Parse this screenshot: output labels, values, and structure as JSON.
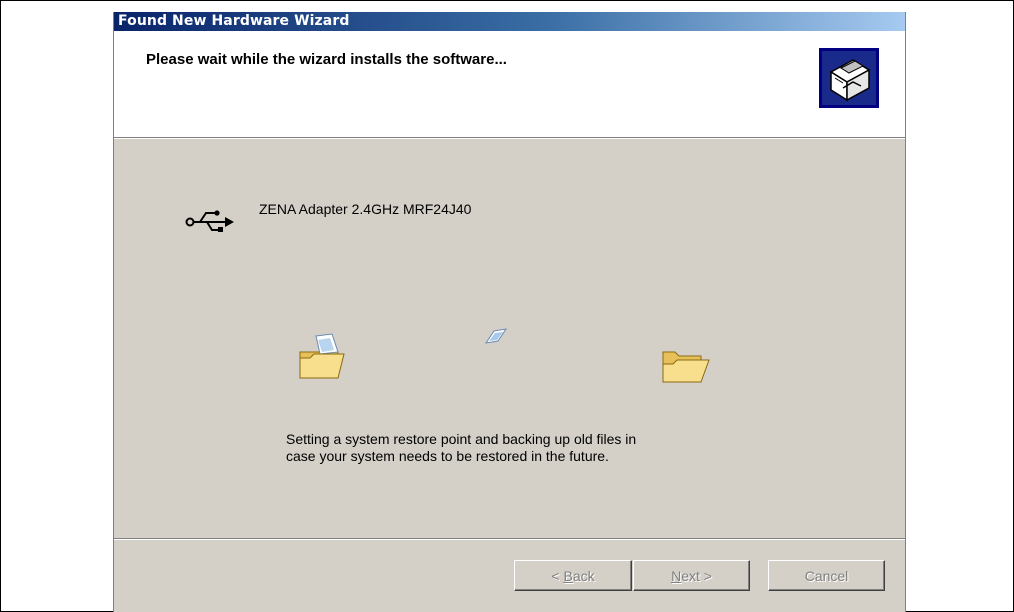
{
  "window": {
    "title": "Found New Hardware Wizard"
  },
  "header": {
    "title": "Please wait while the wizard installs the software...",
    "icon": "hardware-box-icon"
  },
  "device": {
    "icon": "usb-icon",
    "name": "ZENA Adapter 2.4GHz MRF24J40"
  },
  "animation": {
    "source_icon": "folder-with-document-icon",
    "moving_icon": "flying-document-icon",
    "target_icon": "open-folder-icon"
  },
  "status": {
    "line1": "Setting a system restore point and backing up old files in",
    "line2": "case your system needs to be restored in the future."
  },
  "buttons": {
    "back": {
      "prefix": "< ",
      "mnemonic": "B",
      "rest": "ack"
    },
    "next": {
      "mnemonic": "N",
      "rest": "ext >"
    },
    "cancel": "Cancel"
  },
  "colors": {
    "dialog_face": "#d4d0c8",
    "titlebar_start": "#0a246a",
    "titlebar_end": "#a6caf0",
    "disabled_text": "#808080"
  }
}
